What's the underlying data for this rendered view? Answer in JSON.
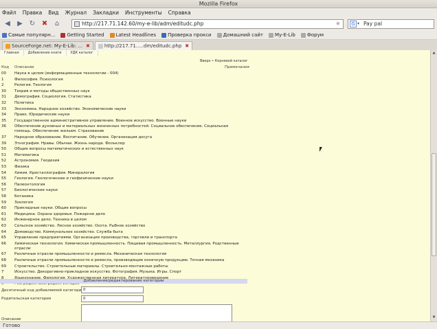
{
  "window": {
    "title": "Mozilla Firefox"
  },
  "menu": [
    "Файл",
    "Правка",
    "Вид",
    "Журнал",
    "Закладки",
    "Инструменты",
    "Справка"
  ],
  "nav": {
    "url": "http://217.71.142.60/my-e-lib/adm/editudc.php",
    "search_engine": "G",
    "search_value": "Pay pal"
  },
  "bookmarks": [
    {
      "label": "Самые популярн...",
      "color": "#4a72c4"
    },
    {
      "label": "Getting Started",
      "color": "#b03030"
    },
    {
      "label": "Latest Headlines",
      "color": "#e08a20"
    },
    {
      "label": "Проверка прокси",
      "color": "#3a6ab8"
    },
    {
      "label": "Домашний сайт",
      "color": "#7a7a7a"
    },
    {
      "label": "My-E-Lib",
      "color": "#7a7a7a"
    },
    {
      "label": "Форум",
      "color": "#7a7a7a"
    }
  ],
  "tabs": [
    {
      "label": "SourceForge.net: My-E-Lib: ..."
    },
    {
      "label": "http://217.71.....dm/editudc.php"
    }
  ],
  "subtabs": [
    "Главная",
    "Добавление книги",
    "УДК каталог"
  ],
  "crumb": "Вверх • Корневой каталог",
  "headers": {
    "code": "Код",
    "desc": "Описание",
    "note": "Примечания"
  },
  "rows": [
    {
      "code": "00",
      "desc": "Наука в целом (информационные технологии - 004)"
    },
    {
      "code": "1",
      "desc": "Философия. Психология"
    },
    {
      "code": "2",
      "desc": "Религия. Теология"
    },
    {
      "code": "30",
      "desc": "Теория и методы общественных наук"
    },
    {
      "code": "31",
      "desc": "Демография. Социология. Статистика"
    },
    {
      "code": "32",
      "desc": "Политика"
    },
    {
      "code": "33",
      "desc": "Экономика. Народное хозяйство. Экономические науки"
    },
    {
      "code": "34",
      "desc": "Право. Юридические науки"
    },
    {
      "code": "35",
      "desc": "Государственное административное управление. Военное искусство. Военные науки"
    },
    {
      "code": "36",
      "desc": "Обеспечение духовных и материальных жизненных потребностей. Социальное обеспечение. Социальная помощь. Обеспечение жильем. Страхование"
    },
    {
      "code": "37",
      "desc": "Народное образование. Воспитание. Обучение. Организация досуга"
    },
    {
      "code": "39",
      "desc": "Этнография. Нравы. Обычаи. Жизнь народа. Фольклор"
    },
    {
      "code": "50",
      "desc": "Общие вопросы математических и естественных наук"
    },
    {
      "code": "51",
      "desc": "Математика"
    },
    {
      "code": "52",
      "desc": "Астрономия. Геодезия"
    },
    {
      "code": "53",
      "desc": "Физика"
    },
    {
      "code": "54",
      "desc": "Химия. Кристаллография. Минералогия"
    },
    {
      "code": "55",
      "desc": "Геология. Геологические и геофизические науки"
    },
    {
      "code": "56",
      "desc": "Палеонтология"
    },
    {
      "code": "57",
      "desc": "Биологические науки"
    },
    {
      "code": "58",
      "desc": "Ботаника"
    },
    {
      "code": "59",
      "desc": "Зоология"
    },
    {
      "code": "60",
      "desc": "Прикладные науки. Общие вопросы"
    },
    {
      "code": "61",
      "desc": "Медицина. Охрана здоровья. Пожарное дело"
    },
    {
      "code": "62",
      "desc": "Инженерное дело. Техника в целом"
    },
    {
      "code": "63",
      "desc": "Сельское хозяйство. Лесное хозяйство. Охота. Рыбное хозяйство"
    },
    {
      "code": "64",
      "desc": "Домоводство. Коммунальное хозяйство. Служба быта"
    },
    {
      "code": "65",
      "desc": "Управление предприятиями. Организация производства, торговли и транспорта"
    },
    {
      "code": "66",
      "desc": "Химическая технология. Химическая промышленность. Пищевая промышленность. Металлургия. Родственные отрасли"
    },
    {
      "code": "67",
      "desc": "Различные отрасли промышленности и ремесла. Механическая технология"
    },
    {
      "code": "68",
      "desc": "Различные отрасли промышленности и ремесла, производящие конечную продукцию. Точная механика"
    },
    {
      "code": "69",
      "desc": "Строительство. Строительные материалы. Строительно-монтажные работы"
    },
    {
      "code": "7",
      "desc": "Искусство. Декоративно-прикладное искусство. Фотография. Музыка. Игры. Спорт"
    },
    {
      "code": "8",
      "desc": "Языкознание. Филология. Художественная литература. Литературоведение"
    },
    {
      "code": "9",
      "desc": "География. Биография. История"
    }
  ],
  "form": {
    "title": "Добавление/редактирование категории",
    "code_label": "Десятичный код добавляемой категории",
    "code_value": "0",
    "parent_label": "Родительская категория",
    "parent_value": "0",
    "desc_label": "Описание"
  },
  "status": "Готово"
}
